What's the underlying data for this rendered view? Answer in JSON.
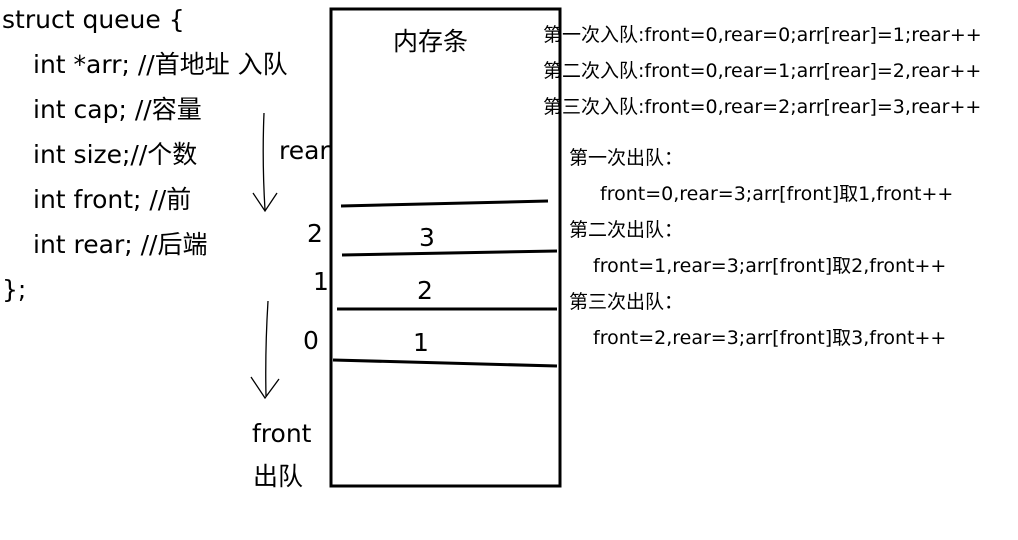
{
  "code": {
    "line1": "struct queue {",
    "line2": "int *arr; //首地址 入队",
    "line3": "int cap; //容量",
    "line4": "int size;//个数",
    "line5": "int front; //前",
    "line6": "int rear; //后端",
    "line7": "};"
  },
  "memory": {
    "title": "内存条",
    "index_2": "2",
    "index_1": "1",
    "index_0": "0",
    "slot_top": "3",
    "slot_mid": "2",
    "slot_bottom": "1"
  },
  "pointers": {
    "rear": "rear",
    "front": "front",
    "dequeue": "出队"
  },
  "enqueue_notes": [
    "第一次入队:front=0,rear=0;arr[rear]=1;rear++",
    "第二次入队:front=0,rear=1;arr[rear]=2,rear++",
    "第三次入队:front=0,rear=2;arr[rear]=3,rear++"
  ],
  "dequeue_notes": {
    "first_title": "第一次出队：",
    "first_detail": "front=0,rear=3;arr[front]取1,front++",
    "second_title": "第二次出队：",
    "second_detail": "front=1,rear=3;arr[front]取2,front++",
    "third_title": "第三次出队：",
    "third_detail": "front=2,rear=3;arr[front]取3,front++"
  }
}
